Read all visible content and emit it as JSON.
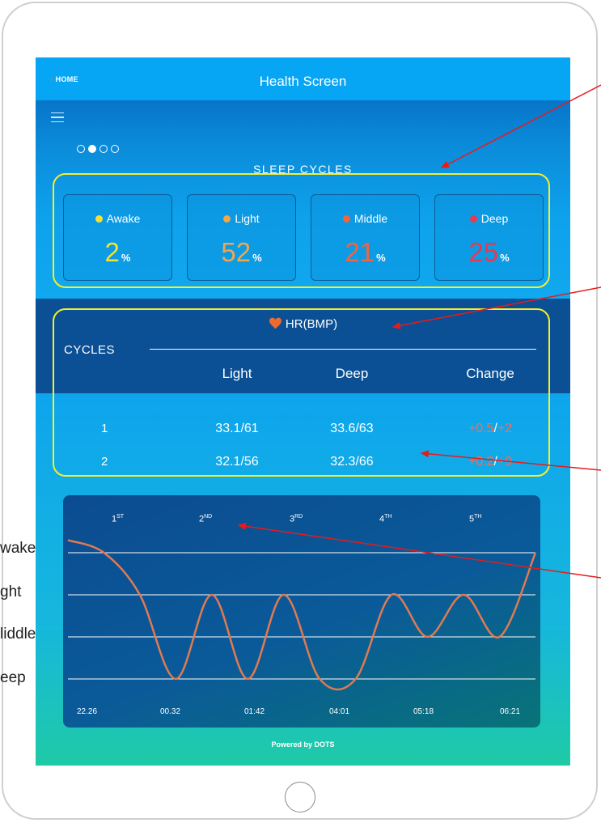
{
  "header": {
    "home_label": "HOME",
    "title": "Health Screen"
  },
  "pager": {
    "dots": 4,
    "active_index": 1
  },
  "sleep_cycles": {
    "title": "SLEEP CYCLES",
    "stages": [
      {
        "label": "Awake",
        "value": "2",
        "unit": "%",
        "color": "#f4e133"
      },
      {
        "label": "Light",
        "value": "52",
        "unit": "%",
        "color": "#f2a64a"
      },
      {
        "label": "Middle",
        "value": "21",
        "unit": "%",
        "color": "#f2643c"
      },
      {
        "label": "Deep",
        "value": "25",
        "unit": "%",
        "color": "#e83a4f"
      }
    ]
  },
  "heart_rate": {
    "title": "HR(BMP)",
    "cycles_label": "CYCLES",
    "columns": [
      "Light",
      "Deep",
      "Change"
    ],
    "rows": [
      {
        "cycle": "1",
        "light": "33.1/61",
        "deep": "33.6/63",
        "change_a": "+0.5",
        "change_b": "+2"
      },
      {
        "cycle": "2",
        "light": "32.1/56",
        "deep": "32.3/66",
        "change_a": "+0.2",
        "change_b": "+9"
      }
    ]
  },
  "chart_data": {
    "type": "line",
    "cycle_labels": [
      {
        "base": "1",
        "sup": "ST"
      },
      {
        "base": "2",
        "sup": "ND"
      },
      {
        "base": "3",
        "sup": "RD"
      },
      {
        "base": "4",
        "sup": "TH"
      },
      {
        "base": "5",
        "sup": "TH"
      }
    ],
    "time_labels": [
      "22.26",
      "00.32",
      "01:42",
      "04:01",
      "05:18",
      "06:21"
    ],
    "stage_levels": [
      "Awake",
      "Light",
      "Middle",
      "Deep"
    ],
    "series": [
      {
        "name": "",
        "color": "#e07a52",
        "values": [
          3.3,
          3.0,
          2.0,
          0.0,
          2.0,
          0.0,
          2.0,
          0.0,
          0.0,
          2.0,
          1.0,
          2.0,
          1.0,
          3.0
        ]
      }
    ],
    "grid": true
  },
  "annotations": {
    "left_labels": [
      "wake",
      "ght",
      "liddle",
      "eep"
    ],
    "arrow_color": "#e81b1b",
    "highlight_color": "#f6ef2a"
  },
  "footer": {
    "powered": "Powered by DOTS"
  }
}
